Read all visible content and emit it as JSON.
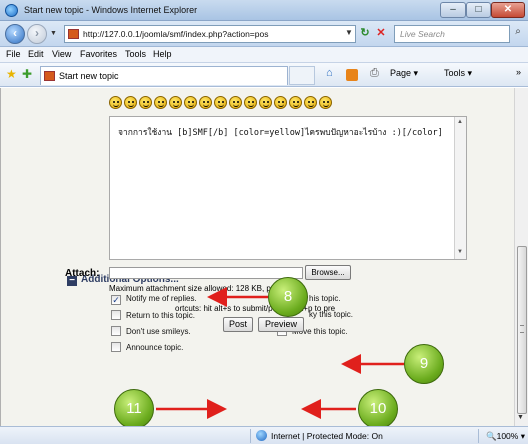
{
  "window": {
    "title": "Start new topic - Windows Internet Explorer",
    "minimize": "–",
    "maximize": "□",
    "close": "✕"
  },
  "address": {
    "url": "http://127.0.0.1/joomla/smf/index.php?action=pos",
    "search_placeholder": "Live Search"
  },
  "menu": [
    "File",
    "Edit",
    "View",
    "Favorites",
    "Tools",
    "Help"
  ],
  "toolbar": {
    "tab_label": "Start new topic",
    "page": "Page ▾",
    "tools": "Tools ▾",
    "overflow": "»"
  },
  "editor": {
    "smiley_count": 15,
    "text": "จากการใช้งาน  [b]SMF[/b] [color=yellow]ไครพบปัญหาอะไรบ้าง  :)[/color]"
  },
  "options": {
    "heading": "Additional Options...",
    "notify": {
      "label": "Notify me of replies.",
      "checked": true
    },
    "return": {
      "label": "Return to this topic.",
      "checked": false
    },
    "smileys": {
      "label": "Don't use smileys.",
      "checked": false
    },
    "announce": {
      "label": "Announce topic.",
      "checked": false
    },
    "lock_suffix": "his topic.",
    "sticky_suffix": "ky this topic.",
    "move": {
      "label": "Move this topic.",
      "checked": false
    }
  },
  "attach": {
    "label": "Attach:",
    "browse": "Browse...",
    "note": "Maximum attachment size allowed: 128 KB, per post: 4"
  },
  "shortcut_note": "ortcuts: hit alt+s to submit/post or alt+p to pre",
  "buttons": {
    "post": "Post",
    "preview": "Preview"
  },
  "callouts": {
    "notify": "8",
    "browse": "9",
    "preview": "10",
    "post": "11"
  },
  "status": {
    "zone": "Internet | Protected Mode: On",
    "zoom": "100%"
  },
  "colors": {
    "callout": "#6aab1d",
    "arrow": "#e0201c",
    "heading": "#2e3d63",
    "page_bg": "#f3f3ee"
  }
}
